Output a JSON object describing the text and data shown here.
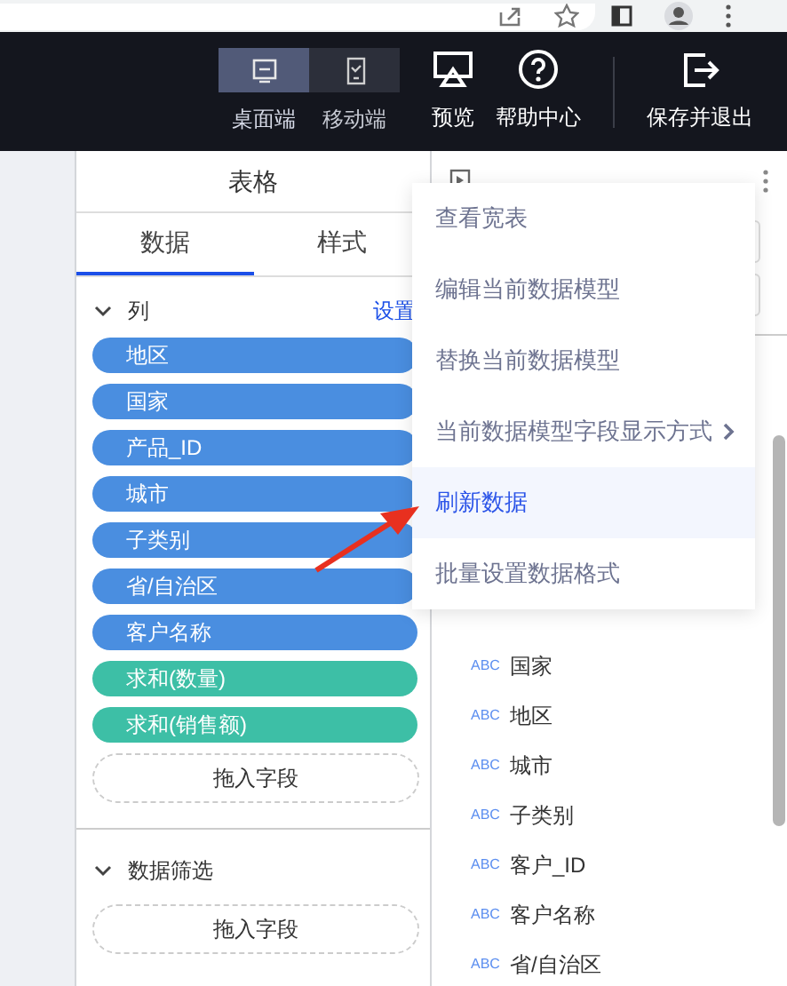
{
  "toolbar": {
    "devices": [
      {
        "label": "桌面端",
        "kind": "desktop",
        "selected": true
      },
      {
        "label": "移动端",
        "kind": "mobile",
        "selected": false
      }
    ],
    "actions": [
      {
        "label": "预览",
        "kind": "preview"
      },
      {
        "label": "帮助中心",
        "kind": "help"
      },
      {
        "label": "保存并退出",
        "kind": "exit"
      }
    ]
  },
  "left_panel": {
    "title": "表格",
    "tabs": [
      {
        "label": "数据",
        "selected": true
      },
      {
        "label": "样式",
        "selected": false
      }
    ],
    "columns_section": {
      "title": "列",
      "link": "设置",
      "fields": [
        {
          "label": "地区",
          "kind": "dimension"
        },
        {
          "label": "国家",
          "kind": "dimension"
        },
        {
          "label": "产品_ID",
          "kind": "dimension"
        },
        {
          "label": "城市",
          "kind": "dimension"
        },
        {
          "label": "子类别",
          "kind": "dimension"
        },
        {
          "label": "省/自治区",
          "kind": "dimension"
        },
        {
          "label": "客户名称",
          "kind": "dimension"
        },
        {
          "label": "求和(数量)",
          "kind": "measure"
        },
        {
          "label": "求和(销售额)",
          "kind": "measure"
        }
      ],
      "drop_zone": "拖入字段"
    },
    "filter_section": {
      "title": "数据筛选",
      "drop_zone": "拖入字段"
    }
  },
  "right_panel": {
    "fields": [
      {
        "type": "ABC",
        "label": "国家"
      },
      {
        "type": "ABC",
        "label": "地区"
      },
      {
        "type": "ABC",
        "label": "城市"
      },
      {
        "type": "ABC",
        "label": "子类别"
      },
      {
        "type": "ABC",
        "label": "客户_ID"
      },
      {
        "type": "ABC",
        "label": "客户名称"
      },
      {
        "type": "ABC",
        "label": "省/自治区"
      }
    ]
  },
  "context_menu": [
    {
      "label": "查看宽表",
      "selected": false,
      "kind": "item"
    },
    {
      "label": "编辑当前数据模型",
      "selected": false,
      "kind": "item"
    },
    {
      "label": "替换当前数据模型",
      "selected": false,
      "kind": "item"
    },
    {
      "label": "当前数据模型字段显示方式",
      "selected": false,
      "kind": "submenu"
    },
    {
      "label": "刷新数据",
      "selected": true,
      "kind": "item"
    },
    {
      "label": "批量设置数据格式",
      "selected": false,
      "kind": "item"
    }
  ]
}
